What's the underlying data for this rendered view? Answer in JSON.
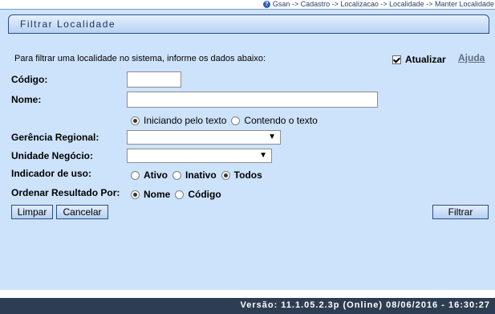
{
  "breadcrumb": "Gsan -> Cadastro -> Localizacao -> Localidade -> Manter Localidade",
  "panel": {
    "title": "Filtrar Localidade",
    "intro": "Para filtrar uma localidade no sistema, informe os dados abaixo:",
    "atualizar_label": "Atualizar",
    "atualizar_checked": true,
    "ajuda_label": "Ajuda"
  },
  "form": {
    "codigo_label": "Código:",
    "codigo_value": "",
    "nome_label": "Nome:",
    "nome_value": "",
    "nome_option_iniciando": "Iniciando pelo texto",
    "nome_option_contendo": "Contendo o texto",
    "gerencia_label": "Gerência Regional:",
    "gerencia_value": "",
    "unidade_label": "Unidade Negócio:",
    "unidade_value": "",
    "indicador_label": "Indicador de uso:",
    "indicador_ativo": "Ativo",
    "indicador_inativo": "Inativo",
    "indicador_todos": "Todos",
    "ordenar_label": "Ordenar Resultado Por:",
    "ordenar_nome": "Nome",
    "ordenar_codigo": "Código"
  },
  "buttons": {
    "limpar": "Limpar",
    "cancelar": "Cancelar",
    "filtrar": "Filtrar"
  },
  "footer": {
    "version": "Versão: 11.1.05.2.3p (Online) 08/06/2016 - 16:30:27"
  },
  "colors": {
    "panel_bg": "#cde3fb",
    "footer_bg": "#2e3e52",
    "title_border": "#2c4d8a"
  },
  "icons": {
    "breadcrumb": "help-globe-icon",
    "select_arrow": "dropdown-arrow-icon"
  }
}
